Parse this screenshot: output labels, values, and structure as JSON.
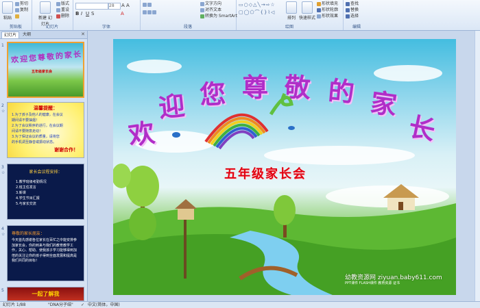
{
  "ribbon": {
    "clipboard": {
      "paste": "粘贴",
      "cut": "剪切",
      "copy": "复制",
      "format_painter": "格式刷",
      "label": "剪贴板"
    },
    "slides": {
      "new_slide": "新建\n幻灯片",
      "layout": "版式",
      "reset": "重设",
      "delete": "删除",
      "label": "幻灯片"
    },
    "font": {
      "size": "28",
      "label": "字体"
    },
    "paragraph": {
      "text_direction": "文字方向",
      "align_text": "对齐文本",
      "smartart": "转换为 SmartArt",
      "label": "段落"
    },
    "drawing": {
      "arrange": "排列",
      "quick_styles": "快速样式",
      "shape_fill": "形状填充",
      "shape_outline": "形状轮廓",
      "shape_effects": "形状效果",
      "label": "绘图"
    },
    "editing": {
      "find": "查找",
      "replace": "替换",
      "select": "选择",
      "label": "编辑"
    }
  },
  "panel": {
    "tabs": [
      "幻灯片",
      "大纲"
    ],
    "thumbnails": [
      {
        "num": "1",
        "title": "欢迎您尊敬的家长",
        "subtitle": "五年级家长会"
      },
      {
        "num": "2",
        "heading": "温馨提醒：",
        "lines": [
          "1.为了孩子及他人的健康，在会议",
          "  期间请不要抽烟！",
          "2.为了会议秩序的进行，在会议期",
          "  间请不要随意走动！",
          "3.为了保证会议的质量，请将您",
          "  的手机调至静音或振动状态。"
        ],
        "thanks": "谢谢合作！"
      },
      {
        "num": "3",
        "heading": "家长会议程安排：",
        "lines": [
          "1.教学班级考勤情况",
          "2.班主任发言",
          "3.新课",
          "4.学生节目汇报",
          "5.与家长交流"
        ]
      },
      {
        "num": "4",
        "heading": "尊敬的家长朋友：",
        "para": "今天首先感谢各位家长在百忙之中能安排参加家长会，你的到来与我们的教育教学工作，关心、帮助、使我孩子学习能够得到加倍的关注让你的孩子得到全面发展和提高是我们共同的目标！"
      },
      {
        "num": "5",
        "heading": "一起了解我"
      }
    ]
  },
  "slide": {
    "title_chars": [
      "欢",
      "迎",
      "您",
      "尊",
      "敬",
      "的",
      "家",
      "长"
    ],
    "subtitle": "五年级家长会",
    "watermark": "幼教资源网 ziyuan.baby611.com",
    "watermark_small": "PPT课件 FLASH课件 教育资源  证书"
  },
  "status": {
    "slide_info": "幻灯片 1/88",
    "theme": "\"DNA分子结\"",
    "language": "中文(简体，中国)"
  },
  "colors": {
    "title": "#b02ec8",
    "subtitle": "#e00010",
    "selection": "#f0a030"
  }
}
